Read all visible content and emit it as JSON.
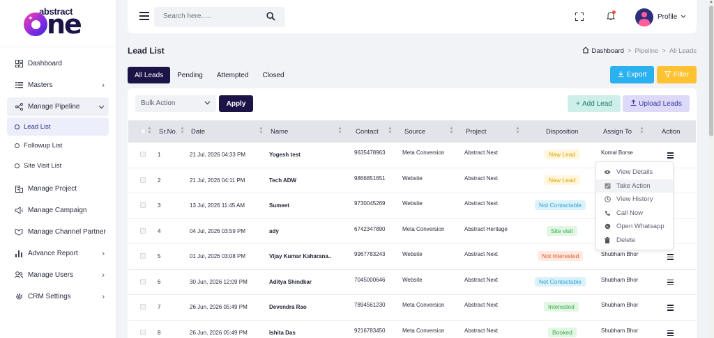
{
  "brand": {
    "top": "abstract",
    "bottom": "ne"
  },
  "sidebar": {
    "items": [
      {
        "label": "Dashboard",
        "icon": "dashboard-icon"
      },
      {
        "label": "Masters",
        "icon": "list-icon",
        "chevron": "›"
      },
      {
        "label": "Manage Pipeline",
        "icon": "pipeline-icon",
        "chevron": "⌄"
      }
    ],
    "sub_items": [
      {
        "label": "Lead List",
        "active": true
      },
      {
        "label": "Followup List"
      },
      {
        "label": "Site Visit List"
      }
    ],
    "items2": [
      {
        "label": "Manage Project",
        "icon": "building-icon"
      },
      {
        "label": "Manage Campaign",
        "icon": "megaphone-icon"
      },
      {
        "label": "Manage Channel Partner",
        "icon": "handshake-icon"
      },
      {
        "label": "Advance Report",
        "icon": "bar-chart-icon",
        "chevron": "›"
      },
      {
        "label": "Manage Users",
        "icon": "users-icon",
        "chevron": "›"
      },
      {
        "label": "CRM Settings",
        "icon": "gear-icon",
        "chevron": "›"
      }
    ]
  },
  "topbar": {
    "search_placeholder": "Search here.....",
    "profile_label": "Profile"
  },
  "page": {
    "title": "Lead List",
    "breadcrumb": [
      "Dashboard",
      "Pipeline",
      "All Leads"
    ],
    "breadcrumb_sep": ">"
  },
  "tabs": [
    "All Leads",
    "Pending",
    "Attempted",
    "Closed"
  ],
  "buttons": {
    "export": "Export",
    "filter": "Filter",
    "bulk_action": "Bulk Action",
    "apply": "Apply",
    "add_lead": "Add Lead",
    "upload_leads": "Upload Leads"
  },
  "table": {
    "headers": [
      "Sr.No.",
      "Date",
      "Name",
      "Contact",
      "Source",
      "Project",
      "Disposition",
      "Assign To",
      "Action"
    ],
    "rows": [
      {
        "sr": "1",
        "date": "21 Jul, 2026 04:33 PM",
        "name": "Yogesh test",
        "contact": "9635478963",
        "source": "Meta Conversion",
        "project": "Abstract Next",
        "disposition": "New Lead",
        "badge": "b-new",
        "assign": "Komal Borse"
      },
      {
        "sr": "2",
        "date": "21 Jul, 2026 04:11 PM",
        "name": "Tech ADW",
        "contact": "9866851651",
        "source": "Website",
        "project": "Abstract Next",
        "disposition": "New Lead",
        "badge": "b-new",
        "assign": ""
      },
      {
        "sr": "3",
        "date": "13 Jul, 2026 11:45 AM",
        "name": "Sumeet",
        "contact": "9730045269",
        "source": "Website",
        "project": "Abstract Next",
        "disposition": "Not Contactable",
        "badge": "b-nc",
        "assign": ""
      },
      {
        "sr": "4",
        "date": "04 Jul, 2026 03:59 PM",
        "name": "ady",
        "contact": "6742347890",
        "source": "Meta Conversion",
        "project": "Abstract Heritage",
        "disposition": "Site visit",
        "badge": "b-site",
        "assign": ""
      },
      {
        "sr": "5",
        "date": "01 Jul, 2026 03:08 PM",
        "name": "Vijay Kumar Kaharana..",
        "contact": "9967783243",
        "source": "Website",
        "project": "Abstract Next",
        "disposition": "Not Interested",
        "badge": "b-ni",
        "assign": "Shubham Bhor"
      },
      {
        "sr": "6",
        "date": "30 Jun, 2026 12:09 PM",
        "name": "Aditya Shindkar",
        "contact": "7045000646",
        "source": "Website",
        "project": "Abstract Next",
        "disposition": "Not Contactable",
        "badge": "b-nc",
        "assign": "Shubham Bhor"
      },
      {
        "sr": "7",
        "date": "26 Jun, 2026 05:49 PM",
        "name": "Devendra Rao",
        "contact": "7894561230",
        "source": "Meta Conversion",
        "project": "Abstract Next",
        "disposition": "Interested",
        "badge": "b-int",
        "assign": "Shubham Bhor"
      },
      {
        "sr": "8",
        "date": "26 Jun, 2026 05:49 PM",
        "name": "Ishita Das",
        "contact": "9216783450",
        "source": "Meta Conversion",
        "project": "Abstract Next",
        "disposition": "Booked",
        "badge": "b-book",
        "assign": "Shubham Bhor"
      }
    ]
  },
  "action_menu": [
    {
      "label": "View Details",
      "icon": "eye-icon"
    },
    {
      "label": "Take Action",
      "icon": "edit-icon"
    },
    {
      "label": "View History",
      "icon": "history-icon"
    },
    {
      "label": "Call Now",
      "icon": "phone-icon"
    },
    {
      "label": "Open Whatsapp",
      "icon": "whatsapp-icon"
    },
    {
      "label": "Delete",
      "icon": "trash-icon"
    }
  ],
  "colors": {
    "primary": "#1c1447",
    "export": "#2bb0f0",
    "filter": "#ffc233",
    "accent_pink": "#ff3fa4"
  }
}
